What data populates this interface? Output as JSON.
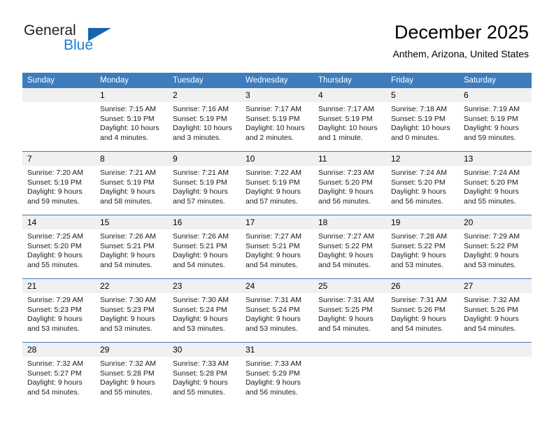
{
  "brand": {
    "name_part1": "General",
    "name_part2": "Blue",
    "logo_icon": "blue-triangle-logo"
  },
  "header": {
    "title": "December 2025",
    "location": "Anthem, Arizona, United States"
  },
  "colors": {
    "header_blue": "#3d7cbd",
    "brand_blue": "#1a7fd4",
    "daynum_bg": "#f0f0f0",
    "page_bg": "#ffffff"
  },
  "weekdays": [
    "Sunday",
    "Monday",
    "Tuesday",
    "Wednesday",
    "Thursday",
    "Friday",
    "Saturday"
  ],
  "weeks": [
    [
      {
        "day": "",
        "lines": []
      },
      {
        "day": "1",
        "lines": [
          "Sunrise: 7:15 AM",
          "Sunset: 5:19 PM",
          "Daylight: 10 hours",
          "and 4 minutes."
        ]
      },
      {
        "day": "2",
        "lines": [
          "Sunrise: 7:16 AM",
          "Sunset: 5:19 PM",
          "Daylight: 10 hours",
          "and 3 minutes."
        ]
      },
      {
        "day": "3",
        "lines": [
          "Sunrise: 7:17 AM",
          "Sunset: 5:19 PM",
          "Daylight: 10 hours",
          "and 2 minutes."
        ]
      },
      {
        "day": "4",
        "lines": [
          "Sunrise: 7:17 AM",
          "Sunset: 5:19 PM",
          "Daylight: 10 hours",
          "and 1 minute."
        ]
      },
      {
        "day": "5",
        "lines": [
          "Sunrise: 7:18 AM",
          "Sunset: 5:19 PM",
          "Daylight: 10 hours",
          "and 0 minutes."
        ]
      },
      {
        "day": "6",
        "lines": [
          "Sunrise: 7:19 AM",
          "Sunset: 5:19 PM",
          "Daylight: 9 hours",
          "and 59 minutes."
        ]
      }
    ],
    [
      {
        "day": "7",
        "lines": [
          "Sunrise: 7:20 AM",
          "Sunset: 5:19 PM",
          "Daylight: 9 hours",
          "and 59 minutes."
        ]
      },
      {
        "day": "8",
        "lines": [
          "Sunrise: 7:21 AM",
          "Sunset: 5:19 PM",
          "Daylight: 9 hours",
          "and 58 minutes."
        ]
      },
      {
        "day": "9",
        "lines": [
          "Sunrise: 7:21 AM",
          "Sunset: 5:19 PM",
          "Daylight: 9 hours",
          "and 57 minutes."
        ]
      },
      {
        "day": "10",
        "lines": [
          "Sunrise: 7:22 AM",
          "Sunset: 5:19 PM",
          "Daylight: 9 hours",
          "and 57 minutes."
        ]
      },
      {
        "day": "11",
        "lines": [
          "Sunrise: 7:23 AM",
          "Sunset: 5:20 PM",
          "Daylight: 9 hours",
          "and 56 minutes."
        ]
      },
      {
        "day": "12",
        "lines": [
          "Sunrise: 7:24 AM",
          "Sunset: 5:20 PM",
          "Daylight: 9 hours",
          "and 56 minutes."
        ]
      },
      {
        "day": "13",
        "lines": [
          "Sunrise: 7:24 AM",
          "Sunset: 5:20 PM",
          "Daylight: 9 hours",
          "and 55 minutes."
        ]
      }
    ],
    [
      {
        "day": "14",
        "lines": [
          "Sunrise: 7:25 AM",
          "Sunset: 5:20 PM",
          "Daylight: 9 hours",
          "and 55 minutes."
        ]
      },
      {
        "day": "15",
        "lines": [
          "Sunrise: 7:26 AM",
          "Sunset: 5:21 PM",
          "Daylight: 9 hours",
          "and 54 minutes."
        ]
      },
      {
        "day": "16",
        "lines": [
          "Sunrise: 7:26 AM",
          "Sunset: 5:21 PM",
          "Daylight: 9 hours",
          "and 54 minutes."
        ]
      },
      {
        "day": "17",
        "lines": [
          "Sunrise: 7:27 AM",
          "Sunset: 5:21 PM",
          "Daylight: 9 hours",
          "and 54 minutes."
        ]
      },
      {
        "day": "18",
        "lines": [
          "Sunrise: 7:27 AM",
          "Sunset: 5:22 PM",
          "Daylight: 9 hours",
          "and 54 minutes."
        ]
      },
      {
        "day": "19",
        "lines": [
          "Sunrise: 7:28 AM",
          "Sunset: 5:22 PM",
          "Daylight: 9 hours",
          "and 53 minutes."
        ]
      },
      {
        "day": "20",
        "lines": [
          "Sunrise: 7:29 AM",
          "Sunset: 5:22 PM",
          "Daylight: 9 hours",
          "and 53 minutes."
        ]
      }
    ],
    [
      {
        "day": "21",
        "lines": [
          "Sunrise: 7:29 AM",
          "Sunset: 5:23 PM",
          "Daylight: 9 hours",
          "and 53 minutes."
        ]
      },
      {
        "day": "22",
        "lines": [
          "Sunrise: 7:30 AM",
          "Sunset: 5:23 PM",
          "Daylight: 9 hours",
          "and 53 minutes."
        ]
      },
      {
        "day": "23",
        "lines": [
          "Sunrise: 7:30 AM",
          "Sunset: 5:24 PM",
          "Daylight: 9 hours",
          "and 53 minutes."
        ]
      },
      {
        "day": "24",
        "lines": [
          "Sunrise: 7:31 AM",
          "Sunset: 5:24 PM",
          "Daylight: 9 hours",
          "and 53 minutes."
        ]
      },
      {
        "day": "25",
        "lines": [
          "Sunrise: 7:31 AM",
          "Sunset: 5:25 PM",
          "Daylight: 9 hours",
          "and 54 minutes."
        ]
      },
      {
        "day": "26",
        "lines": [
          "Sunrise: 7:31 AM",
          "Sunset: 5:26 PM",
          "Daylight: 9 hours",
          "and 54 minutes."
        ]
      },
      {
        "day": "27",
        "lines": [
          "Sunrise: 7:32 AM",
          "Sunset: 5:26 PM",
          "Daylight: 9 hours",
          "and 54 minutes."
        ]
      }
    ],
    [
      {
        "day": "28",
        "lines": [
          "Sunrise: 7:32 AM",
          "Sunset: 5:27 PM",
          "Daylight: 9 hours",
          "and 54 minutes."
        ]
      },
      {
        "day": "29",
        "lines": [
          "Sunrise: 7:32 AM",
          "Sunset: 5:28 PM",
          "Daylight: 9 hours",
          "and 55 minutes."
        ]
      },
      {
        "day": "30",
        "lines": [
          "Sunrise: 7:33 AM",
          "Sunset: 5:28 PM",
          "Daylight: 9 hours",
          "and 55 minutes."
        ]
      },
      {
        "day": "31",
        "lines": [
          "Sunrise: 7:33 AM",
          "Sunset: 5:29 PM",
          "Daylight: 9 hours",
          "and 56 minutes."
        ]
      },
      {
        "day": "",
        "lines": []
      },
      {
        "day": "",
        "lines": []
      },
      {
        "day": "",
        "lines": []
      }
    ]
  ]
}
